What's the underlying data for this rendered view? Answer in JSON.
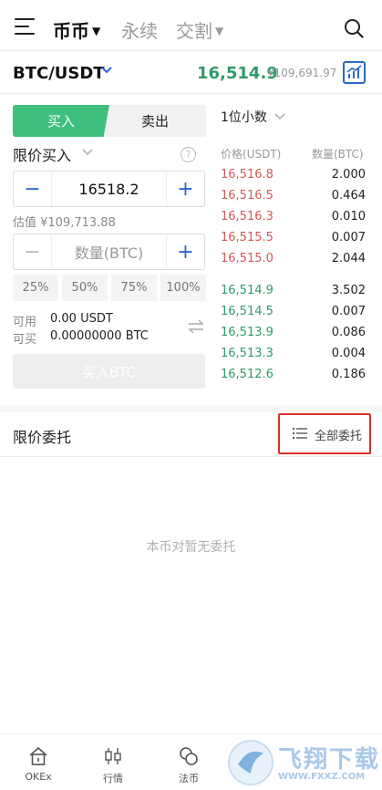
{
  "tabs": [
    {
      "label": "币币",
      "active": true,
      "caret": "▼"
    },
    {
      "label": "永续",
      "active": false
    },
    {
      "label": "交割",
      "active": false,
      "caret": "▼"
    }
  ],
  "pair": {
    "symbol": "BTC/USDT",
    "last_price": "16,514.9",
    "cny_price": "¥109,691.97"
  },
  "trade": {
    "buy_label": "买入",
    "sell_label": "卖出",
    "order_type": "限价买入",
    "help": "?",
    "price_value": "16518.2",
    "estimate": "估值 ¥109,713.88",
    "qty_placeholder": "数量(BTC)",
    "percents": [
      "25%",
      "50%",
      "75%",
      "100%"
    ],
    "available_label": "可用",
    "available_value": "0.00 USDT",
    "buyable_label": "可买",
    "buyable_value": "0.00000000 BTC",
    "submit_label": "买入BTC"
  },
  "orderbook": {
    "decimals": "1位小数",
    "price_header": "价格(USDT)",
    "qty_header": "数量(BTC)",
    "asks": [
      {
        "price": "16,516.8",
        "qty": "2.000"
      },
      {
        "price": "16,516.5",
        "qty": "0.464"
      },
      {
        "price": "16,516.3",
        "qty": "0.010"
      },
      {
        "price": "16,515.5",
        "qty": "0.007"
      },
      {
        "price": "16,515.0",
        "qty": "2.044"
      }
    ],
    "bids": [
      {
        "price": "16,514.9",
        "qty": "3.502"
      },
      {
        "price": "16,514.5",
        "qty": "0.007"
      },
      {
        "price": "16,513.9",
        "qty": "0.086"
      },
      {
        "price": "16,513.3",
        "qty": "0.004"
      },
      {
        "price": "16,512.6",
        "qty": "0.186"
      }
    ]
  },
  "orders": {
    "title": "限价委托",
    "all_label": "全部委托",
    "empty": "本币对暂无委托"
  },
  "nav": [
    {
      "label": "OKEx",
      "icon": "home-icon"
    },
    {
      "label": "行情",
      "icon": "candlestick-icon"
    },
    {
      "label": "法币",
      "icon": "fiat-icon"
    }
  ],
  "watermark": {
    "text": "飞翔下载",
    "site": "WWW.FXXZ.COM"
  },
  "colors": {
    "green": "#2e9a6a",
    "red": "#d05a57",
    "blue": "#2a67c9",
    "buy": "#3fbf7d",
    "highlight": "#d93025"
  }
}
